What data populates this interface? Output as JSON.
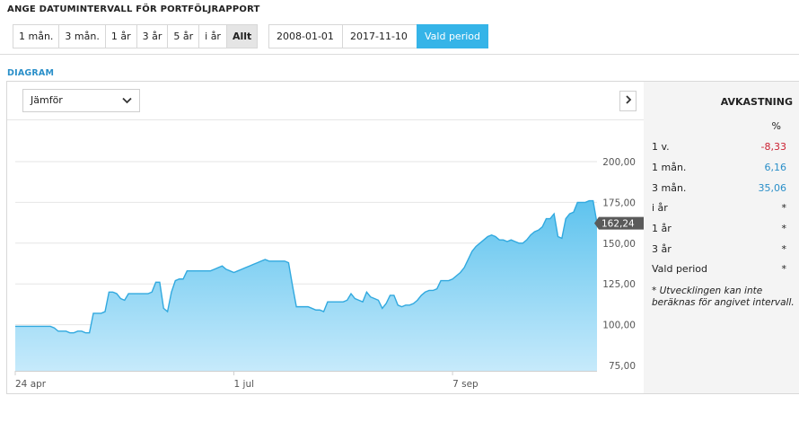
{
  "range_section": {
    "title": "ANGE DATUMINTERVALL FÖR PORTFÖLJRAPPORT",
    "buttons": [
      {
        "label": "1 mån.",
        "active": false
      },
      {
        "label": "3 mån.",
        "active": false
      },
      {
        "label": "1 år",
        "active": false
      },
      {
        "label": "3 år",
        "active": false
      },
      {
        "label": "5 år",
        "active": false
      },
      {
        "label": "i år",
        "active": false
      },
      {
        "label": "Allt",
        "active": true
      }
    ],
    "from_date": "2008-01-01",
    "to_date": "2017-11-10",
    "period_button": "Vald period"
  },
  "diagram": {
    "title": "DIAGRAM",
    "compare_select": "Jämför"
  },
  "chart_data": {
    "type": "area",
    "color": "#35b4e8",
    "y_ticks": [
      75,
      100,
      125,
      150,
      175,
      200
    ],
    "y_tick_labels": [
      "75,00",
      "100,00",
      "125,00",
      "150,00",
      "175,00",
      "200,00"
    ],
    "ylim": [
      75,
      210
    ],
    "x_ticks": [
      {
        "label": "24 apr",
        "index": 0
      },
      {
        "label": "1 jul",
        "index": 56
      },
      {
        "label": "7 sep",
        "index": 112
      }
    ],
    "grid": true,
    "last_value_label": "162,24",
    "values": [
      99,
      99,
      99,
      99,
      99,
      99,
      99,
      99,
      99,
      99,
      98,
      96,
      96,
      96,
      95,
      95,
      96,
      96,
      95,
      95,
      107,
      107,
      107,
      108,
      120,
      120,
      119,
      116,
      115,
      119,
      119,
      119,
      119,
      119,
      119,
      120,
      126,
      126,
      110,
      108,
      120,
      127,
      128,
      128,
      133,
      133,
      133,
      133,
      133,
      133,
      133,
      134,
      135,
      136,
      134,
      133,
      132,
      133,
      134,
      135,
      136,
      137,
      138,
      139,
      140,
      139,
      139,
      139,
      139,
      139,
      138,
      124,
      111,
      111,
      111,
      111,
      110,
      109,
      109,
      108,
      114,
      114,
      114,
      114,
      114,
      115,
      119,
      116,
      115,
      114,
      120,
      117,
      116,
      115,
      110,
      113,
      118,
      118,
      112,
      111,
      112,
      112,
      113,
      115,
      118,
      120,
      121,
      121,
      122,
      127,
      127,
      127,
      128,
      130,
      132,
      135,
      140,
      145,
      148,
      150,
      152,
      154,
      155,
      154,
      152,
      152,
      151,
      152,
      151,
      150,
      150,
      152,
      155,
      157,
      158,
      160,
      165,
      165,
      168,
      154,
      153,
      165,
      168,
      169,
      175,
      175,
      175,
      176,
      176,
      162.24
    ],
    "total_points": 150
  },
  "returns": {
    "title": "AVKASTNING",
    "unit": "%",
    "rows": [
      {
        "label": "1 v.",
        "value": "-8,33",
        "kind": "neg"
      },
      {
        "label": "1 mån.",
        "value": "6,16",
        "kind": "pos"
      },
      {
        "label": "3 mån.",
        "value": "35,06",
        "kind": "pos"
      },
      {
        "label": "i år",
        "value": "*",
        "kind": "dflt"
      },
      {
        "label": "1 år",
        "value": "*",
        "kind": "dflt"
      },
      {
        "label": "3 år",
        "value": "*",
        "kind": "dflt"
      },
      {
        "label": "Vald period",
        "value": "*",
        "kind": "dflt"
      }
    ],
    "footnote": "* Utvecklingen kan inte beräknas för angivet intervall."
  }
}
